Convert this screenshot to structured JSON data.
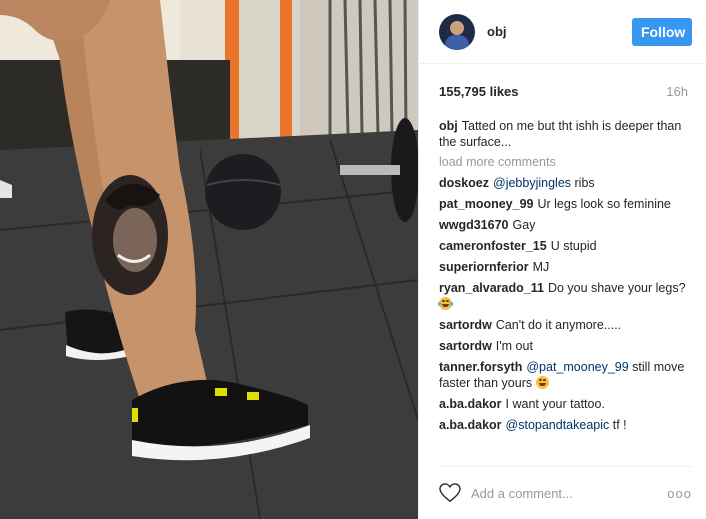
{
  "post": {
    "username": "obj",
    "follow_label": "Follow",
    "likes": "155,795 likes",
    "time": "16h",
    "caption_user": "obj",
    "caption": "Tatted on me but tht ishh is deeper than the surface...",
    "load_more": "load more comments",
    "add_comment_placeholder": "Add a comment...",
    "more_options": "ooo"
  },
  "comments": [
    {
      "user": "doskoez",
      "mention": "@jebbyjingles",
      "text": " ribs"
    },
    {
      "user": "pat_mooney_99",
      "text": "Ur legs look so feminine"
    },
    {
      "user": "wwgd31670",
      "text": "Gay"
    },
    {
      "user": "cameronfoster_15",
      "text": "U stupid"
    },
    {
      "user": "superiornferior",
      "text": "MJ"
    },
    {
      "user": "ryan_alvarado_11",
      "text": "Do you shave your legs?",
      "emoji": "face-with-tears-of-joy"
    },
    {
      "user": "sartordw",
      "text": "Can't do it anymore....."
    },
    {
      "user": "sartordw",
      "text": "I'm out"
    },
    {
      "user": "tanner.forsyth",
      "mention": "@pat_mooney_99",
      "text": " still move faster than yours",
      "emoji": "winking-face"
    },
    {
      "user": "a.ba.dakor",
      "text": "I want your tattoo."
    },
    {
      "user": "a.ba.dakor",
      "mention": "@stopandtakeapic",
      "text": " tf !"
    }
  ],
  "colors": {
    "follow_button": "#3897f0",
    "mention": "#003569",
    "muted": "#999999"
  }
}
